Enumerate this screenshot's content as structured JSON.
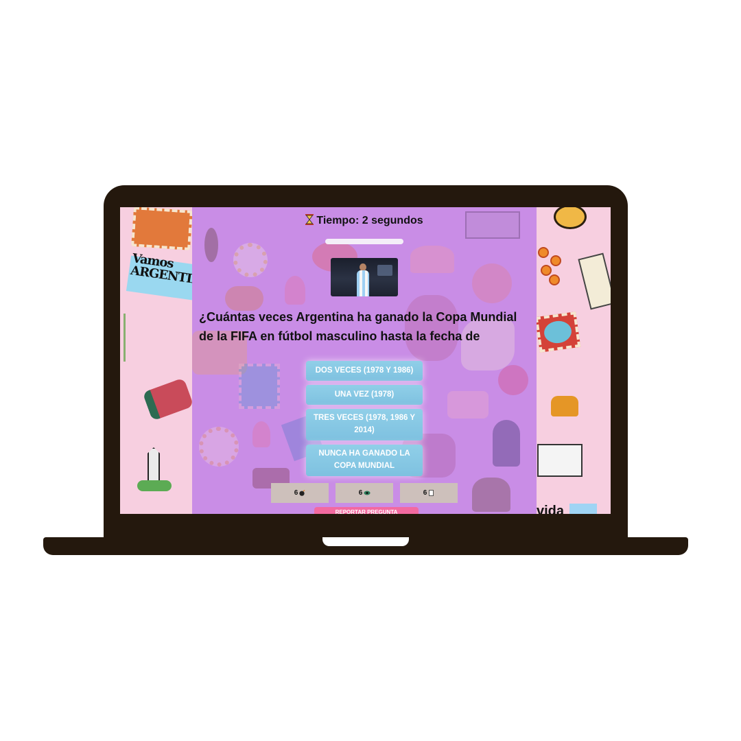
{
  "timer": {
    "icon": "hourglass-icon",
    "label": "Tiempo: 2 segundos",
    "progress": 1.0
  },
  "question": {
    "text": "¿Cuántas veces Argentina ha ganado la Copa Mundial de la FIFA en fútbol masculino hasta la fecha de"
  },
  "answers": [
    {
      "label": "DOS VECES (1978 Y 1986)"
    },
    {
      "label": "UNA VEZ (1978)"
    },
    {
      "label": "TRES VECES (1978, 1986 Y 2014)"
    },
    {
      "label": "NUNCA HA GANADO LA COPA MUNDIAL"
    }
  ],
  "powerups": [
    {
      "count": "6",
      "icon": "bomb-icon"
    },
    {
      "count": "6",
      "icon": "eye-icon"
    },
    {
      "count": "6",
      "icon": "card-icon"
    }
  ],
  "report": {
    "label": "REPORTAR PREGUNTA"
  },
  "stickers": {
    "vamos_line1": "Vamos",
    "vamos_line2": "ARGENTINA",
    "vida": "vida"
  },
  "colors": {
    "panel": "#c98de6",
    "side": "#f7cfe0",
    "answer": "#85c6e4",
    "powerup": "#cdc0bb",
    "report": "#f36aa0",
    "frame": "#24180d"
  }
}
